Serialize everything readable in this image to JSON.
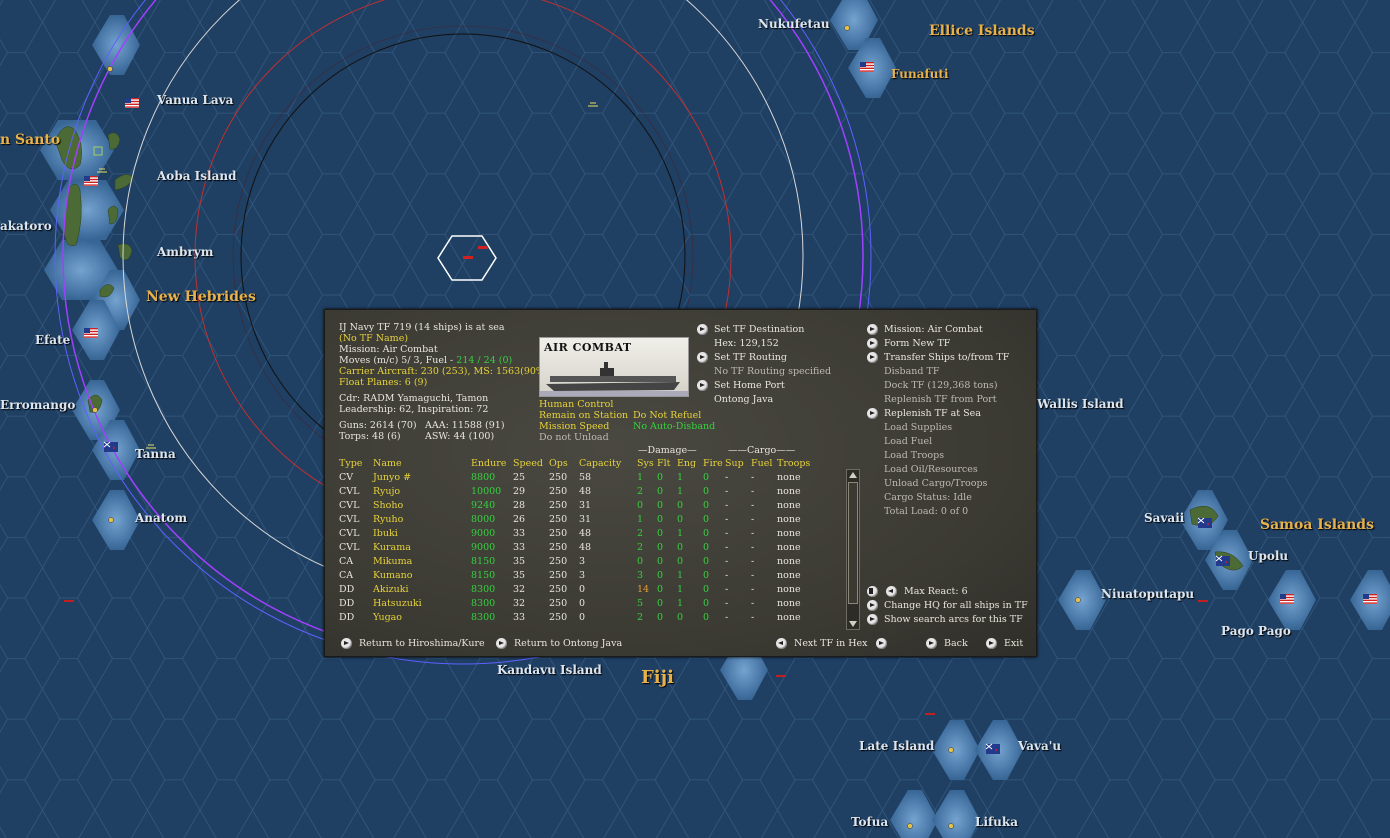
{
  "map": {
    "labels": {
      "nukufetau": "Nukufetau",
      "ellice": "Ellice Islands",
      "funafuti": "Funafuti",
      "vanua_lava": "Vanua Lava",
      "santo": "n Santo",
      "aoba": "Aoba Island",
      "malakatoro": "akatoro",
      "ambrym": "Ambrym",
      "new_hebrides": "New Hebrides",
      "efate": "Efate",
      "erromango": "Erromango",
      "tanna": "Tanna",
      "anatom": "Anatom",
      "wallis": "Wallis Island",
      "savaii": "Savaii",
      "samoa": "Samoa Islands",
      "upolu": "Upolu",
      "niuatoputapu": "Niuatoputapu",
      "pago_pago": "Pago Pago",
      "kandavu": "Kandavu Island",
      "fiji": "Fiji",
      "late_island": "Late Island",
      "vavau": "Vava'u",
      "tofua": "Tofua",
      "lifuka": "Lifuka"
    },
    "colors": {
      "ocean": "#1f3f63",
      "hex_line": "#2f5579",
      "shallow": "#4f7fb0",
      "ring_purple": "#a040ff",
      "ring_red": "#c03030",
      "ring_white": "#d8d8d8",
      "ring_black": "#111111"
    }
  },
  "panel": {
    "header": {
      "tf_line": "IJ Navy TF 719 (14 ships) is at sea",
      "name": "(No TF Name)",
      "mission": "Mission: Air Combat",
      "moves_prefix": "Moves (m/c) 5/ 3, Fuel -",
      "moves_fuel": "214 / 24 (0)",
      "carrier": "Carrier Aircraft: 230 (253), MS: 1563(90%)",
      "float": "Float Planes: 6 (9)",
      "cdr": "Cdr: RADM Yamaguchi, Tamon",
      "leadership": "Leadership: 62, Inspiration: 72",
      "guns": "Guns: 2614 (70)",
      "aaa": "AAA: 11588 (91)",
      "torps": "Torps: 48 (6)",
      "asw": "ASW: 44 (100)"
    },
    "image_title": "AIR COMBAT",
    "control": {
      "human": "Human Control",
      "remain": "Remain on Station",
      "speed": "Mission Speed",
      "unload": "Do not Unload",
      "refuel": "Do Not Refuel",
      "disband": "No Auto-Disband"
    },
    "middle": {
      "set_dest": "Set TF Destination",
      "hex": "Hex: 129,152",
      "set_routing": "Set TF Routing",
      "no_routing": "No TF Routing specified",
      "set_home": "Set Home Port",
      "home": "Ontong Java"
    },
    "right": {
      "mission": "Mission: Air Combat",
      "form": "Form New TF",
      "transfer": "Transfer Ships to/from TF",
      "disband": "Disband TF",
      "dock": "Dock TF (129,368 tons)",
      "replenish_port": "Replenish TF from Port",
      "replenish_sea": "Replenish TF at Sea",
      "load_supplies": "Load Supplies",
      "load_fuel": "Load Fuel",
      "load_troops": "Load Troops",
      "load_oil": "Load Oil/Resources",
      "unload": "Unload Cargo/Troops",
      "cargo_status": "Cargo Status: Idle",
      "total_load": "Total Load: 0 of 0",
      "max_react": "Max React: 6",
      "change_hq": "Change HQ for all ships in TF",
      "show_arcs": "Show search arcs for this TF"
    },
    "table": {
      "group_damage": "—Damage—",
      "group_cargo": "——Cargo——",
      "headers": [
        "Type",
        "Name",
        "Endure",
        "Speed",
        "Ops",
        "Capacity",
        "Sys",
        "Flt",
        "Eng",
        "Fire",
        "Sup",
        "Fuel",
        "Troops"
      ],
      "rows": [
        [
          "CV",
          "Junyo #",
          "8800",
          "25",
          "250",
          "58",
          "1",
          "0",
          "1",
          "0",
          "-",
          "-",
          "none"
        ],
        [
          "CVL",
          "Ryujo",
          "10000",
          "29",
          "250",
          "48",
          "2",
          "0",
          "1",
          "0",
          "-",
          "-",
          "none"
        ],
        [
          "CVL",
          "Shoho",
          "9240",
          "28",
          "250",
          "31",
          "0",
          "0",
          "0",
          "0",
          "-",
          "-",
          "none"
        ],
        [
          "CVL",
          "Ryuho",
          "8000",
          "26",
          "250",
          "31",
          "1",
          "0",
          "0",
          "0",
          "-",
          "-",
          "none"
        ],
        [
          "CVL",
          "Ibuki",
          "9000",
          "33",
          "250",
          "48",
          "2",
          "0",
          "1",
          "0",
          "-",
          "-",
          "none"
        ],
        [
          "CVL",
          "Kurama",
          "9000",
          "33",
          "250",
          "48",
          "2",
          "0",
          "0",
          "0",
          "-",
          "-",
          "none"
        ],
        [
          "CA",
          "Mikuma",
          "8150",
          "35",
          "250",
          "3",
          "0",
          "0",
          "0",
          "0",
          "-",
          "-",
          "none"
        ],
        [
          "CA",
          "Kumano",
          "8150",
          "35",
          "250",
          "3",
          "3",
          "0",
          "1",
          "0",
          "-",
          "-",
          "none"
        ],
        [
          "DD",
          "Akizuki",
          "8300",
          "32",
          "250",
          "0",
          "14",
          "0",
          "1",
          "0",
          "-",
          "-",
          "none"
        ],
        [
          "DD",
          "Hatsuzuki",
          "8300",
          "32",
          "250",
          "0",
          "5",
          "0",
          "1",
          "0",
          "-",
          "-",
          "none"
        ],
        [
          "DD",
          "Yugao",
          "8300",
          "33",
          "250",
          "0",
          "2",
          "0",
          "0",
          "0",
          "-",
          "-",
          "none"
        ]
      ]
    },
    "footer": {
      "return_hiroshima": "Return to Hiroshima/Kure",
      "return_ontong": "Return to Ontong Java",
      "next_tf": "Next TF in Hex",
      "back": "Back",
      "exit": "Exit"
    }
  }
}
